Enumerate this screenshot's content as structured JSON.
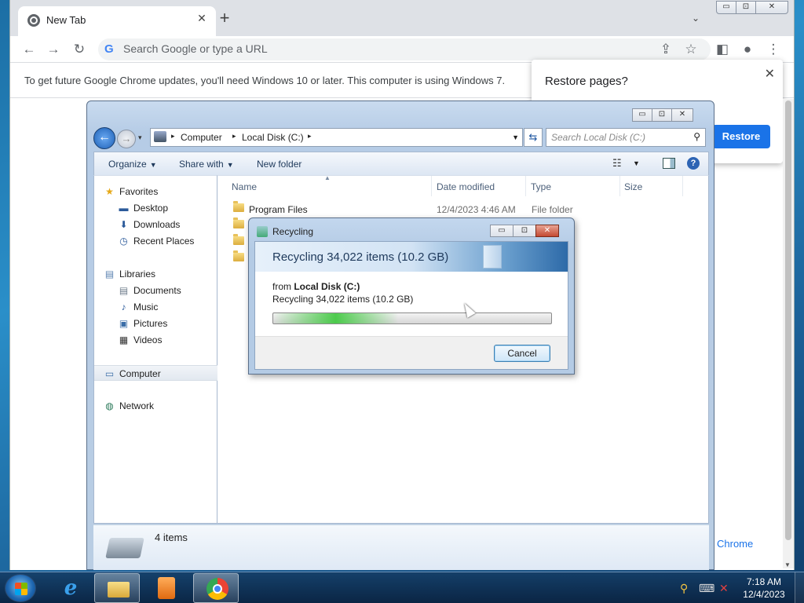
{
  "chrome": {
    "tab_title": "New Tab",
    "tab_close": "✕",
    "new_tab": "+",
    "tab_search": "⌄",
    "window_controls": {
      "minimize": "▭",
      "maximize": "⊡",
      "close": "✕"
    },
    "nav": {
      "back": "←",
      "forward": "→",
      "reload": "↻"
    },
    "omnibox_g": "G",
    "omnibox_placeholder": "Search Google or type a URL",
    "toolbar_icons": {
      "share": "⇪",
      "bookmark": "☆",
      "side_panel": "◧",
      "profile": "●",
      "menu": "⋮"
    },
    "update_message": "To get future Google Chrome updates, you'll need Windows 10 or later. This computer is using Windows 7.",
    "restore_popup": {
      "title": "Restore pages?",
      "button": "Restore",
      "close": "✕"
    },
    "link_text": "Chrome"
  },
  "explorer": {
    "window_controls": {
      "minimize": "▭",
      "maximize": "⊡",
      "close": "✕"
    },
    "nav": {
      "back": "←",
      "forward": "→",
      "history": "▾"
    },
    "breadcrumbs": [
      "Computer",
      "Local Disk (C:)"
    ],
    "crumb_sep": "▸",
    "refresh": "⇆",
    "search_placeholder": "Search Local Disk (C:)",
    "search_icon": "⚲",
    "commands": {
      "organize": "Organize",
      "share_with": "Share with",
      "new_folder": "New folder",
      "dropdown": "▼"
    },
    "view_icon": "☷",
    "help": "?",
    "sidebar": {
      "favorites_label": "Favorites",
      "favorites": [
        "Desktop",
        "Downloads",
        "Recent Places"
      ],
      "libraries_label": "Libraries",
      "libraries": [
        "Documents",
        "Music",
        "Pictures",
        "Videos"
      ],
      "computer_label": "Computer",
      "network_label": "Network",
      "icons": {
        "favorites": "★",
        "desktop": "▬",
        "downloads": "⬇",
        "recent": "◷",
        "libraries": "▤",
        "documents": "▤",
        "music": "♪",
        "pictures": "▣",
        "videos": "▦",
        "computer": "▭",
        "network": "◍"
      }
    },
    "columns": [
      "Name",
      "Date modified",
      "Type",
      "Size"
    ],
    "sort_indicator": "▲",
    "files": [
      {
        "name": "Program Files",
        "date": "12/4/2023 4:46 AM",
        "type": "File folder"
      },
      {
        "name": "",
        "date": "",
        "type": ""
      },
      {
        "name": "",
        "date": "",
        "type": ""
      },
      {
        "name": "",
        "date": "",
        "type": ""
      }
    ],
    "status": "4 items"
  },
  "recycle_dialog": {
    "title": "Recycling",
    "heading": "Recycling 34,022 items (10.2 GB)",
    "from_prefix": "from ",
    "from_location": "Local Disk (C:)",
    "detail": "Recycling 34,022 items (10.2 GB)",
    "progress_fraction": 0.45,
    "cancel": "Cancel",
    "window_controls": {
      "minimize": "▭",
      "maximize": "⊡",
      "close": "✕"
    }
  },
  "taskbar": {
    "ie_glyph": "e",
    "tray_icons": {
      "search": "⚲",
      "network": "⌨",
      "volume": "✕"
    },
    "time": "7:18 AM",
    "date": "12/4/2023"
  }
}
